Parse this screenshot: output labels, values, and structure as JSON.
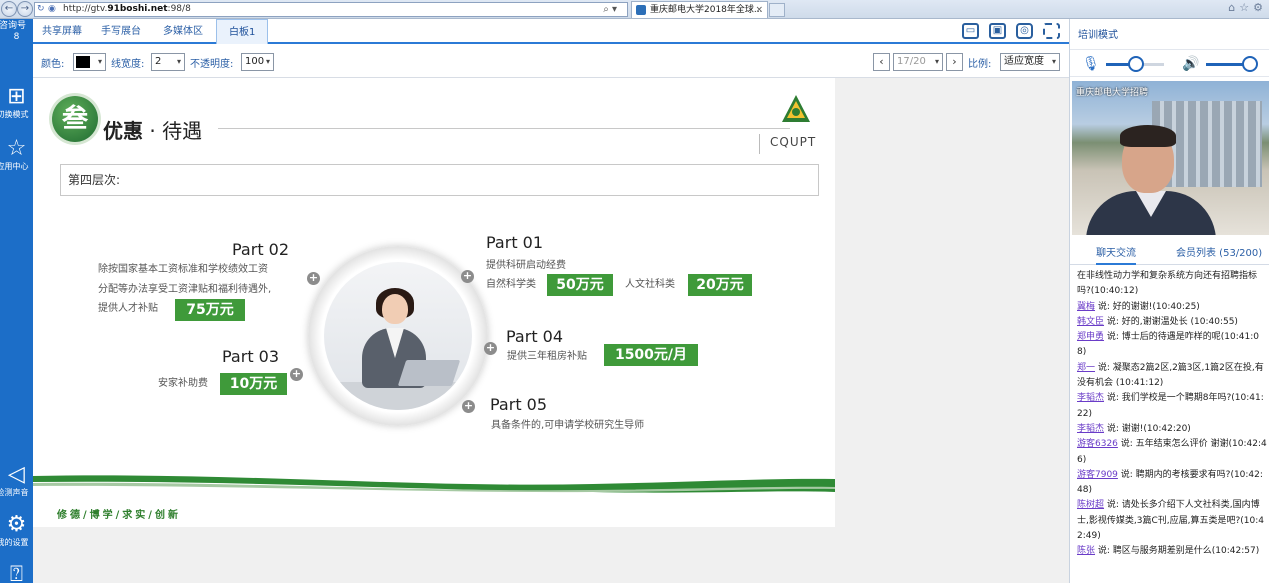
{
  "browser": {
    "url_prefix": "http://gtv.",
    "url_host": "91boshi.net",
    "url_suffix": ":98/8",
    "tab_title": "重庆邮电大学2018年全球...",
    "tab_close": "×"
  },
  "sidebar": {
    "room_label": "咨询号",
    "room_number": "8",
    "switch_mode": "切换模式",
    "app_center": "应用中心",
    "sound_test": "检测声音",
    "my_settings": "我的设置"
  },
  "tabs": [
    {
      "label": "共享屏幕"
    },
    {
      "label": "手写展台"
    },
    {
      "label": "多媒体区"
    },
    {
      "label": "白板1"
    }
  ],
  "toolbar": {
    "color_label": "颜色:",
    "color_value": "#000000",
    "line_width_label": "线宽度:",
    "line_width_value": "2",
    "opacity_label": "不透明度:",
    "opacity_value": "100",
    "page_value": "17/20",
    "ratio_label": "比例:",
    "ratio_value": "适应宽度"
  },
  "slide": {
    "badge": "叁",
    "title_bold": "优惠",
    "title_rest": " · 待遇",
    "school_code": "CQUPT",
    "level": "第四层次:",
    "parts": [
      {
        "name": "Part 02",
        "lines": [
          "除按国家基本工资标准和学校绩效工资",
          "分配等办法享受工资津贴和福利待遇外,",
          "提供人才补贴"
        ],
        "amount": "75万元"
      },
      {
        "name": "Part 01",
        "line1": "提供科研启动经费",
        "sci_label": "自然科学类",
        "sci_amount": "50万元",
        "hum_label": "人文社科类",
        "hum_amount": "20万元"
      },
      {
        "name": "Part 03",
        "line": "安家补助费",
        "amount": "10万元"
      },
      {
        "name": "Part 04",
        "line": "提供三年租房补贴",
        "amount": "1500元/月"
      },
      {
        "name": "Part 05",
        "line": "具备条件的,可申请学校研究生导师"
      }
    ],
    "motto": "修德/博学/求实/创新"
  },
  "right_panel": {
    "mode": "培训模式",
    "video_caption": "重庆邮电大学招聘",
    "tab_chat": "聊天交流",
    "tab_members": "会员列表 (53/200)",
    "chat": [
      {
        "user": "",
        "text": "在非线性动力学和复杂系统方向还有招聘指标吗?(10:40:12)"
      },
      {
        "user": "冀梅",
        "text": " 说: 好的谢谢!(10:40:25)"
      },
      {
        "user": "韩文臣",
        "text": " 说: 好的,谢谢温处长 (10:40:55)"
      },
      {
        "user": "郑申勇",
        "text": " 说: 博士后的待遇是咋样的呢(10:41:08)"
      },
      {
        "user": "郑一",
        "text": " 说: 凝聚态2篇2区,2篇3区,1篇2区在投,有没有机会 (10:41:12)"
      },
      {
        "user": "李韬杰",
        "text": " 说: 我们学校是一个聘期8年吗?(10:41:22)"
      },
      {
        "user": "李韬杰",
        "text": " 说: 谢谢!(10:42:20)"
      },
      {
        "user": "游客6326",
        "text": " 说: 五年结束怎么评价 谢谢(10:42:46)"
      },
      {
        "user": "游客7909",
        "text": " 说: 聘期内的考核要求有吗?(10:42:48)"
      },
      {
        "user": "陈树超",
        "text": " 说: 请处长多介绍下人文社科类,国内博士,影视传媒类,3篇C刊,应届,算五类是吧?(10:42:49)"
      },
      {
        "user": "陈张",
        "text": " 说: 聘区与服务期差别是什么(10:42:57)"
      }
    ]
  },
  "colors": {
    "sidebar": "#1c6ec8",
    "accent": "#2b7ad6",
    "slide_green": "#3f9a3a"
  }
}
